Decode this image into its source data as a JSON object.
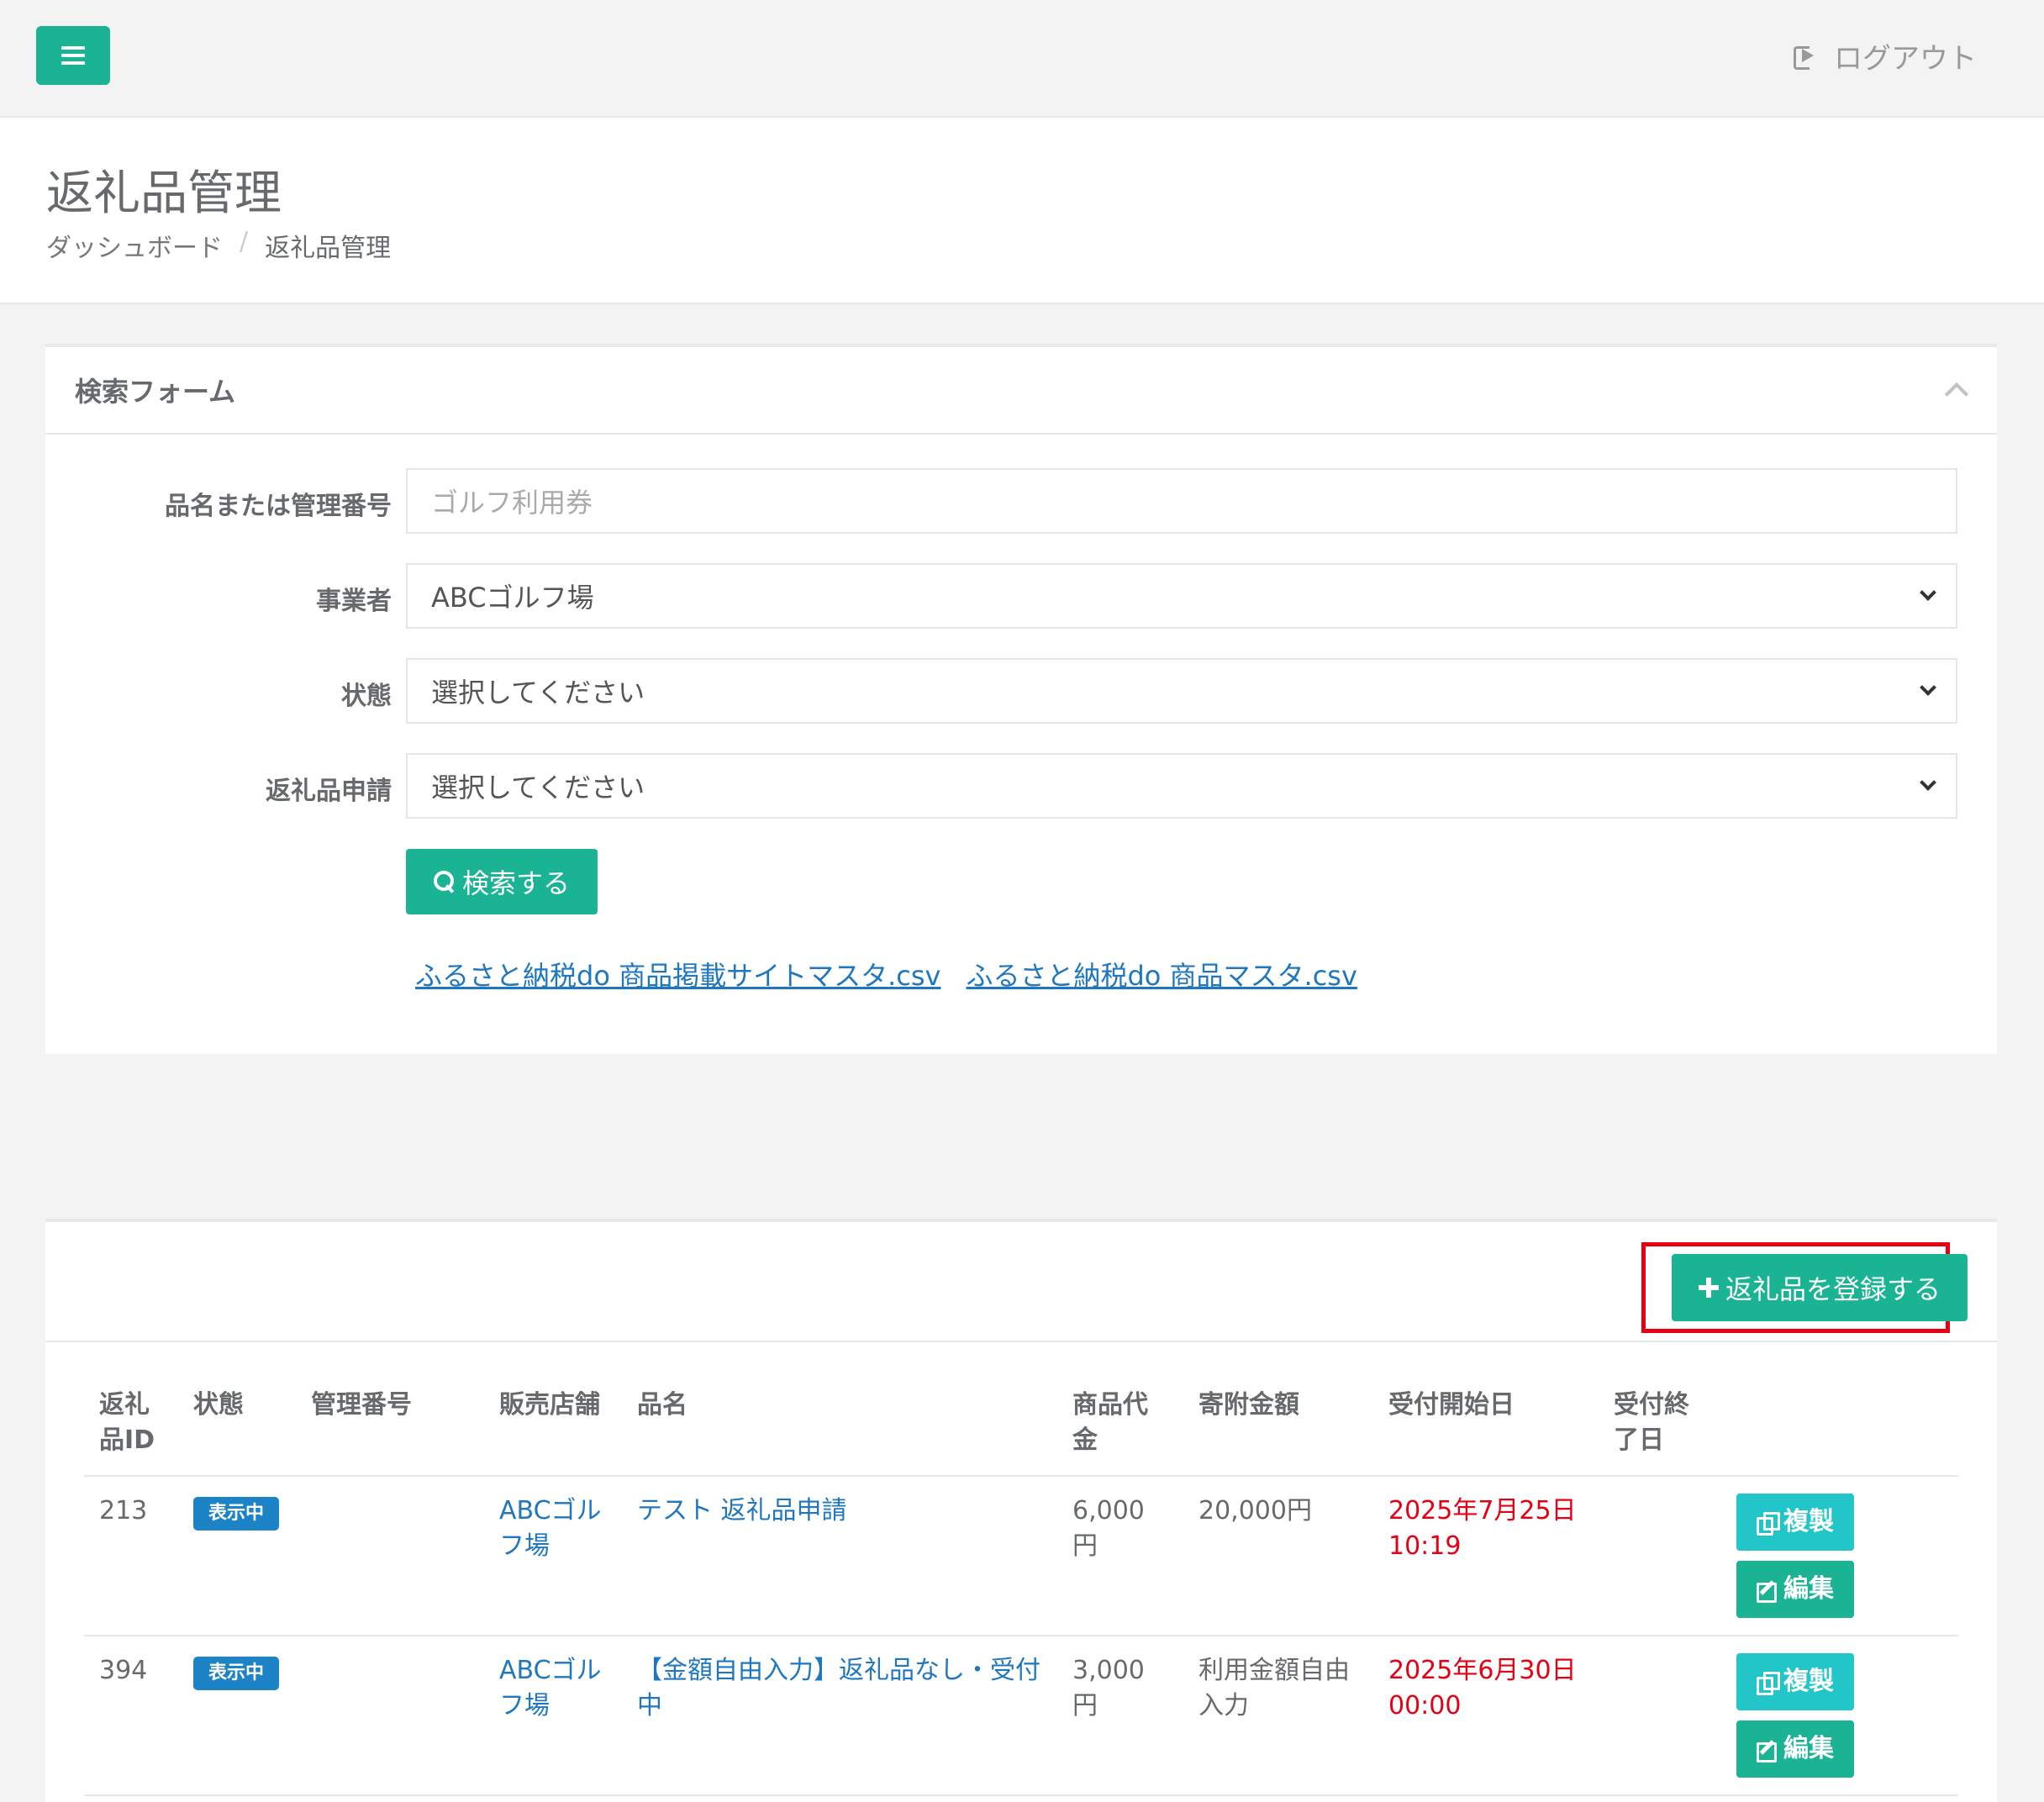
{
  "topbar": {
    "logout_label": "ログアウト"
  },
  "page": {
    "title": "返礼品管理",
    "breadcrumb": {
      "home": "ダッシュボード",
      "separator": "/",
      "current": "返礼品管理"
    }
  },
  "search_form": {
    "title": "検索フォーム",
    "fields": {
      "keyword": {
        "label": "品名または管理番号",
        "placeholder": "ゴルフ利用券"
      },
      "business": {
        "label": "事業者",
        "value": "ABCゴルフ場"
      },
      "status": {
        "label": "状態",
        "value": "選択してください"
      },
      "application": {
        "label": "返礼品申請",
        "value": "選択してください"
      }
    },
    "search_button": "検索する",
    "csv_links": [
      "ふるさと納税do 商品掲載サイトマスタ.csv",
      "ふるさと納税do 商品マスタ.csv"
    ]
  },
  "list": {
    "register_button": "返礼品を登録する",
    "columns": [
      "返礼品ID",
      "状態",
      "管理番号",
      "販売店舗",
      "品名",
      "商品代金",
      "寄附金額",
      "受付開始日",
      "受付終了日",
      ""
    ],
    "rows": [
      {
        "id": "213",
        "status": "表示中",
        "code": "",
        "store": "ABCゴルフ場",
        "name": "テスト 返礼品申請",
        "price": "6,000円",
        "donation": "20,000円",
        "start": "2025年7月25日 10:19",
        "end": ""
      },
      {
        "id": "394",
        "status": "表示中",
        "code": "",
        "store": "ABCゴルフ場",
        "name": "【金額自由入力】返礼品なし・受付中",
        "price": "3,000円",
        "donation": "利用金額自由入力",
        "start": "2025年6月30日 00:00",
        "end": ""
      }
    ],
    "copy_label": "複製",
    "edit_label": "編集"
  },
  "colors": {
    "primary": "#1ab394",
    "info": "#23c6c8",
    "badge": "#1c84c6",
    "highlight": "#e60012"
  }
}
